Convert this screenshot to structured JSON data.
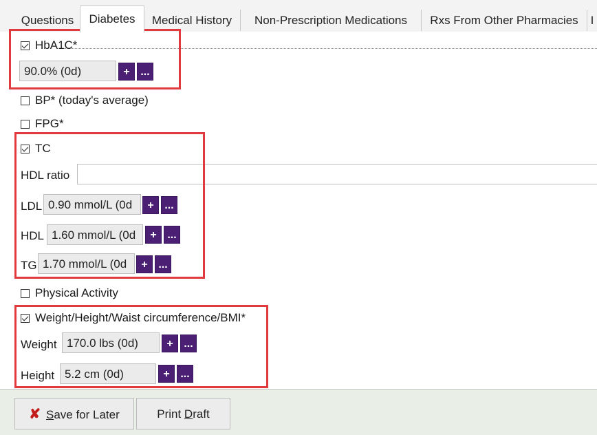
{
  "tabs": [
    "Questions",
    "Diabetes",
    "Medical History",
    "Non-Prescription Medications",
    "Rxs From Other Pharmacies",
    "I"
  ],
  "hba1c": {
    "label": "HbA1C*",
    "checked": true,
    "value": "90.0% (0d)"
  },
  "bp": {
    "label": "BP* (today's average)",
    "checked": false
  },
  "fpg": {
    "label": "FPG*",
    "checked": false
  },
  "tc": {
    "label": "TC",
    "checked": true,
    "hdl_ratio_label": "HDL ratio",
    "hdl_ratio_value": "",
    "ldl_label": "LDL",
    "ldl_value": "0.90 mmol/L (0d",
    "hdl_label": "HDL",
    "hdl_value": "1.60 mmol/L (0d",
    "tg_label": "TG",
    "tg_value": "1.70 mmol/L (0d"
  },
  "physical_activity": {
    "label": "Physical Activity",
    "checked": false
  },
  "whw": {
    "label": "Weight/Height/Waist circumference/BMI*",
    "checked": true,
    "weight_label": "Weight",
    "weight_value": "170.0 lbs (0d)",
    "height_label": "Height",
    "height_value": "5.2 cm (0d)"
  },
  "buttons": {
    "plus": "+",
    "more": "...",
    "x_icon": "✘"
  },
  "footer": {
    "save_prefix": "",
    "save_underline": "S",
    "save_rest": "ave for Later",
    "print_prefix": "Print ",
    "print_underline": "D",
    "print_rest": "raft"
  },
  "colors": {
    "accent": "#4b1f74",
    "highlight": "#e03a3e",
    "footer_bg": "#e9eee7"
  }
}
